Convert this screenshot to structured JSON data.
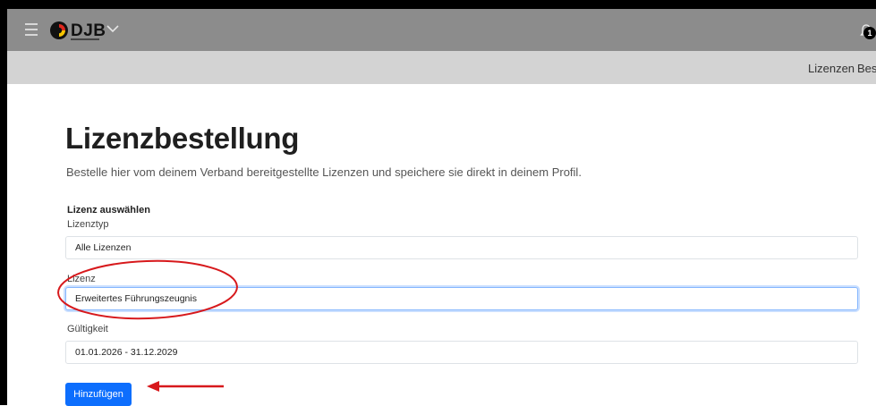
{
  "app": {
    "brand_name": "DJB",
    "notification_count": "1"
  },
  "subnav": {
    "items": [
      {
        "label": "Lizenzen"
      },
      {
        "label": "Best"
      }
    ]
  },
  "page": {
    "title": "Lizenzbestellung",
    "subtitle": "Bestelle hier vom deinem Verband bereitgestellte Lizenzen und speichere sie direkt in deinem Profil."
  },
  "form": {
    "section_title": "Lizenz auswählen",
    "lizenztyp": {
      "label": "Lizenztyp",
      "value": "Alle Lizenzen"
    },
    "lizenz": {
      "label": "Lizenz",
      "value": "Erweitertes Führungszeugnis"
    },
    "gueltigkeit": {
      "label": "Gültigkeit",
      "value": "01.01.2026 - 31.12.2029"
    },
    "submit_label": "Hinzufügen"
  },
  "annotations": {
    "highlight_color": "#d7191c"
  },
  "icons": [
    "menu-icon",
    "djb-logo-icon",
    "chevron-down-icon",
    "bell-icon"
  ]
}
